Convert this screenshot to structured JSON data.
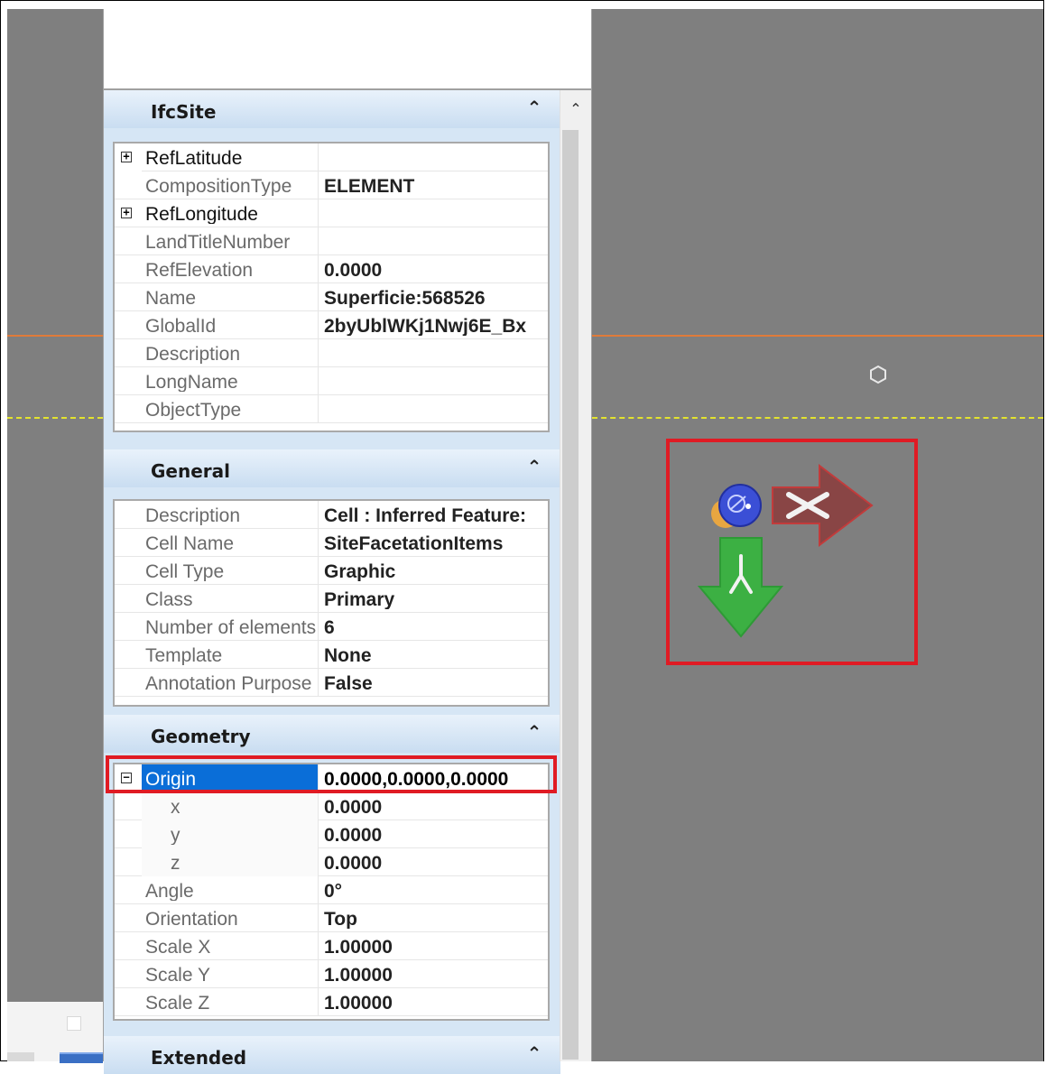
{
  "panel": {
    "sections": {
      "ifcsite": {
        "title": "IfcSite",
        "rows": [
          {
            "name": "RefLatitude",
            "value": "",
            "expandable": true
          },
          {
            "name": "CompositionType",
            "value": "ELEMENT"
          },
          {
            "name": "RefLongitude",
            "value": "",
            "expandable": true
          },
          {
            "name": "LandTitleNumber",
            "value": ""
          },
          {
            "name": "RefElevation",
            "value": "0.0000"
          },
          {
            "name": "Name",
            "value": "Superficie:568526"
          },
          {
            "name": "GlobalId",
            "value": "2byUblWKj1Nwj6E_Bx"
          },
          {
            "name": "Description",
            "value": ""
          },
          {
            "name": "LongName",
            "value": ""
          },
          {
            "name": "ObjectType",
            "value": ""
          }
        ]
      },
      "general": {
        "title": "General",
        "rows": [
          {
            "name": "Description",
            "value": "Cell : Inferred Feature:"
          },
          {
            "name": "Cell Name",
            "value": "SiteFacetationItems"
          },
          {
            "name": "Cell Type",
            "value": "Graphic"
          },
          {
            "name": "Class",
            "value": "Primary"
          },
          {
            "name": "Number of elements",
            "value": "6"
          },
          {
            "name": "Template",
            "value": "None"
          },
          {
            "name": "Annotation Purpose",
            "value": "False"
          }
        ]
      },
      "geometry": {
        "title": "Geometry",
        "rows": [
          {
            "name": "Origin",
            "value": "0.0000,0.0000,0.0000",
            "expanded": true,
            "selected": true
          },
          {
            "name": "x",
            "value": "0.0000"
          },
          {
            "name": "y",
            "value": "0.0000"
          },
          {
            "name": "z",
            "value": "0.0000"
          },
          {
            "name": "Angle",
            "value": "0°"
          },
          {
            "name": "Orientation",
            "value": "Top"
          },
          {
            "name": "Scale X",
            "value": "1.00000"
          },
          {
            "name": "Scale Y",
            "value": "1.00000"
          },
          {
            "name": "Scale Z",
            "value": "1.00000"
          }
        ]
      },
      "extended": {
        "title": "Extended"
      }
    }
  },
  "icons": {
    "expand": "plus-box-icon",
    "collapse": "minus-box-icon",
    "section_collapse": "chevron-up-icon",
    "scroll_up": "scroll-up-arrow-icon",
    "view_x_axis": "x-axis-arrow-icon",
    "view_y_axis": "y-axis-arrow-icon",
    "view_origin": "origin-sphere-icon",
    "view_vertex": "hexagon-snap-icon"
  },
  "colors": {
    "viewport_bg": "#7f7f7f",
    "selection": "#0a6ed8",
    "highlight": "#e01b24",
    "x_axis": "#8b3b3b",
    "y_axis": "#3cb043",
    "orange_line": "#e07b3a",
    "yellow_line": "#e3e32e"
  }
}
